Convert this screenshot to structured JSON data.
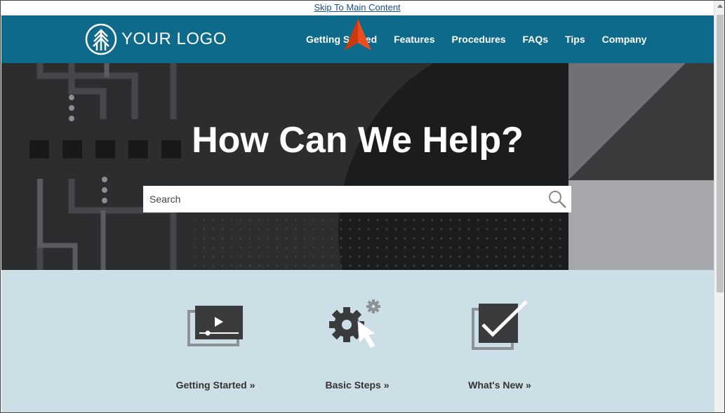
{
  "skip_link": "Skip To Main Content",
  "logo": {
    "text": "YOUR LOGO",
    "icon": "tree-icon"
  },
  "nav": {
    "items": [
      {
        "label": "Getting Started"
      },
      {
        "label": "Features"
      },
      {
        "label": "Procedures"
      },
      {
        "label": "FAQs"
      },
      {
        "label": "Tips"
      },
      {
        "label": "Company"
      }
    ]
  },
  "hero": {
    "title": "How Can We Help?",
    "search_placeholder": "Search",
    "search_icon": "search-icon"
  },
  "cards": [
    {
      "label": "Getting Started »",
      "icon": "video-icon"
    },
    {
      "label": "Basic Steps »",
      "icon": "gear-cursor-icon"
    },
    {
      "label": "What's New »",
      "icon": "checkbox-icon"
    }
  ],
  "colors": {
    "header": "#0e6a8b",
    "hero": "#232425",
    "cards_bg": "#cddfe6",
    "cursor": "#ee4d1f"
  }
}
